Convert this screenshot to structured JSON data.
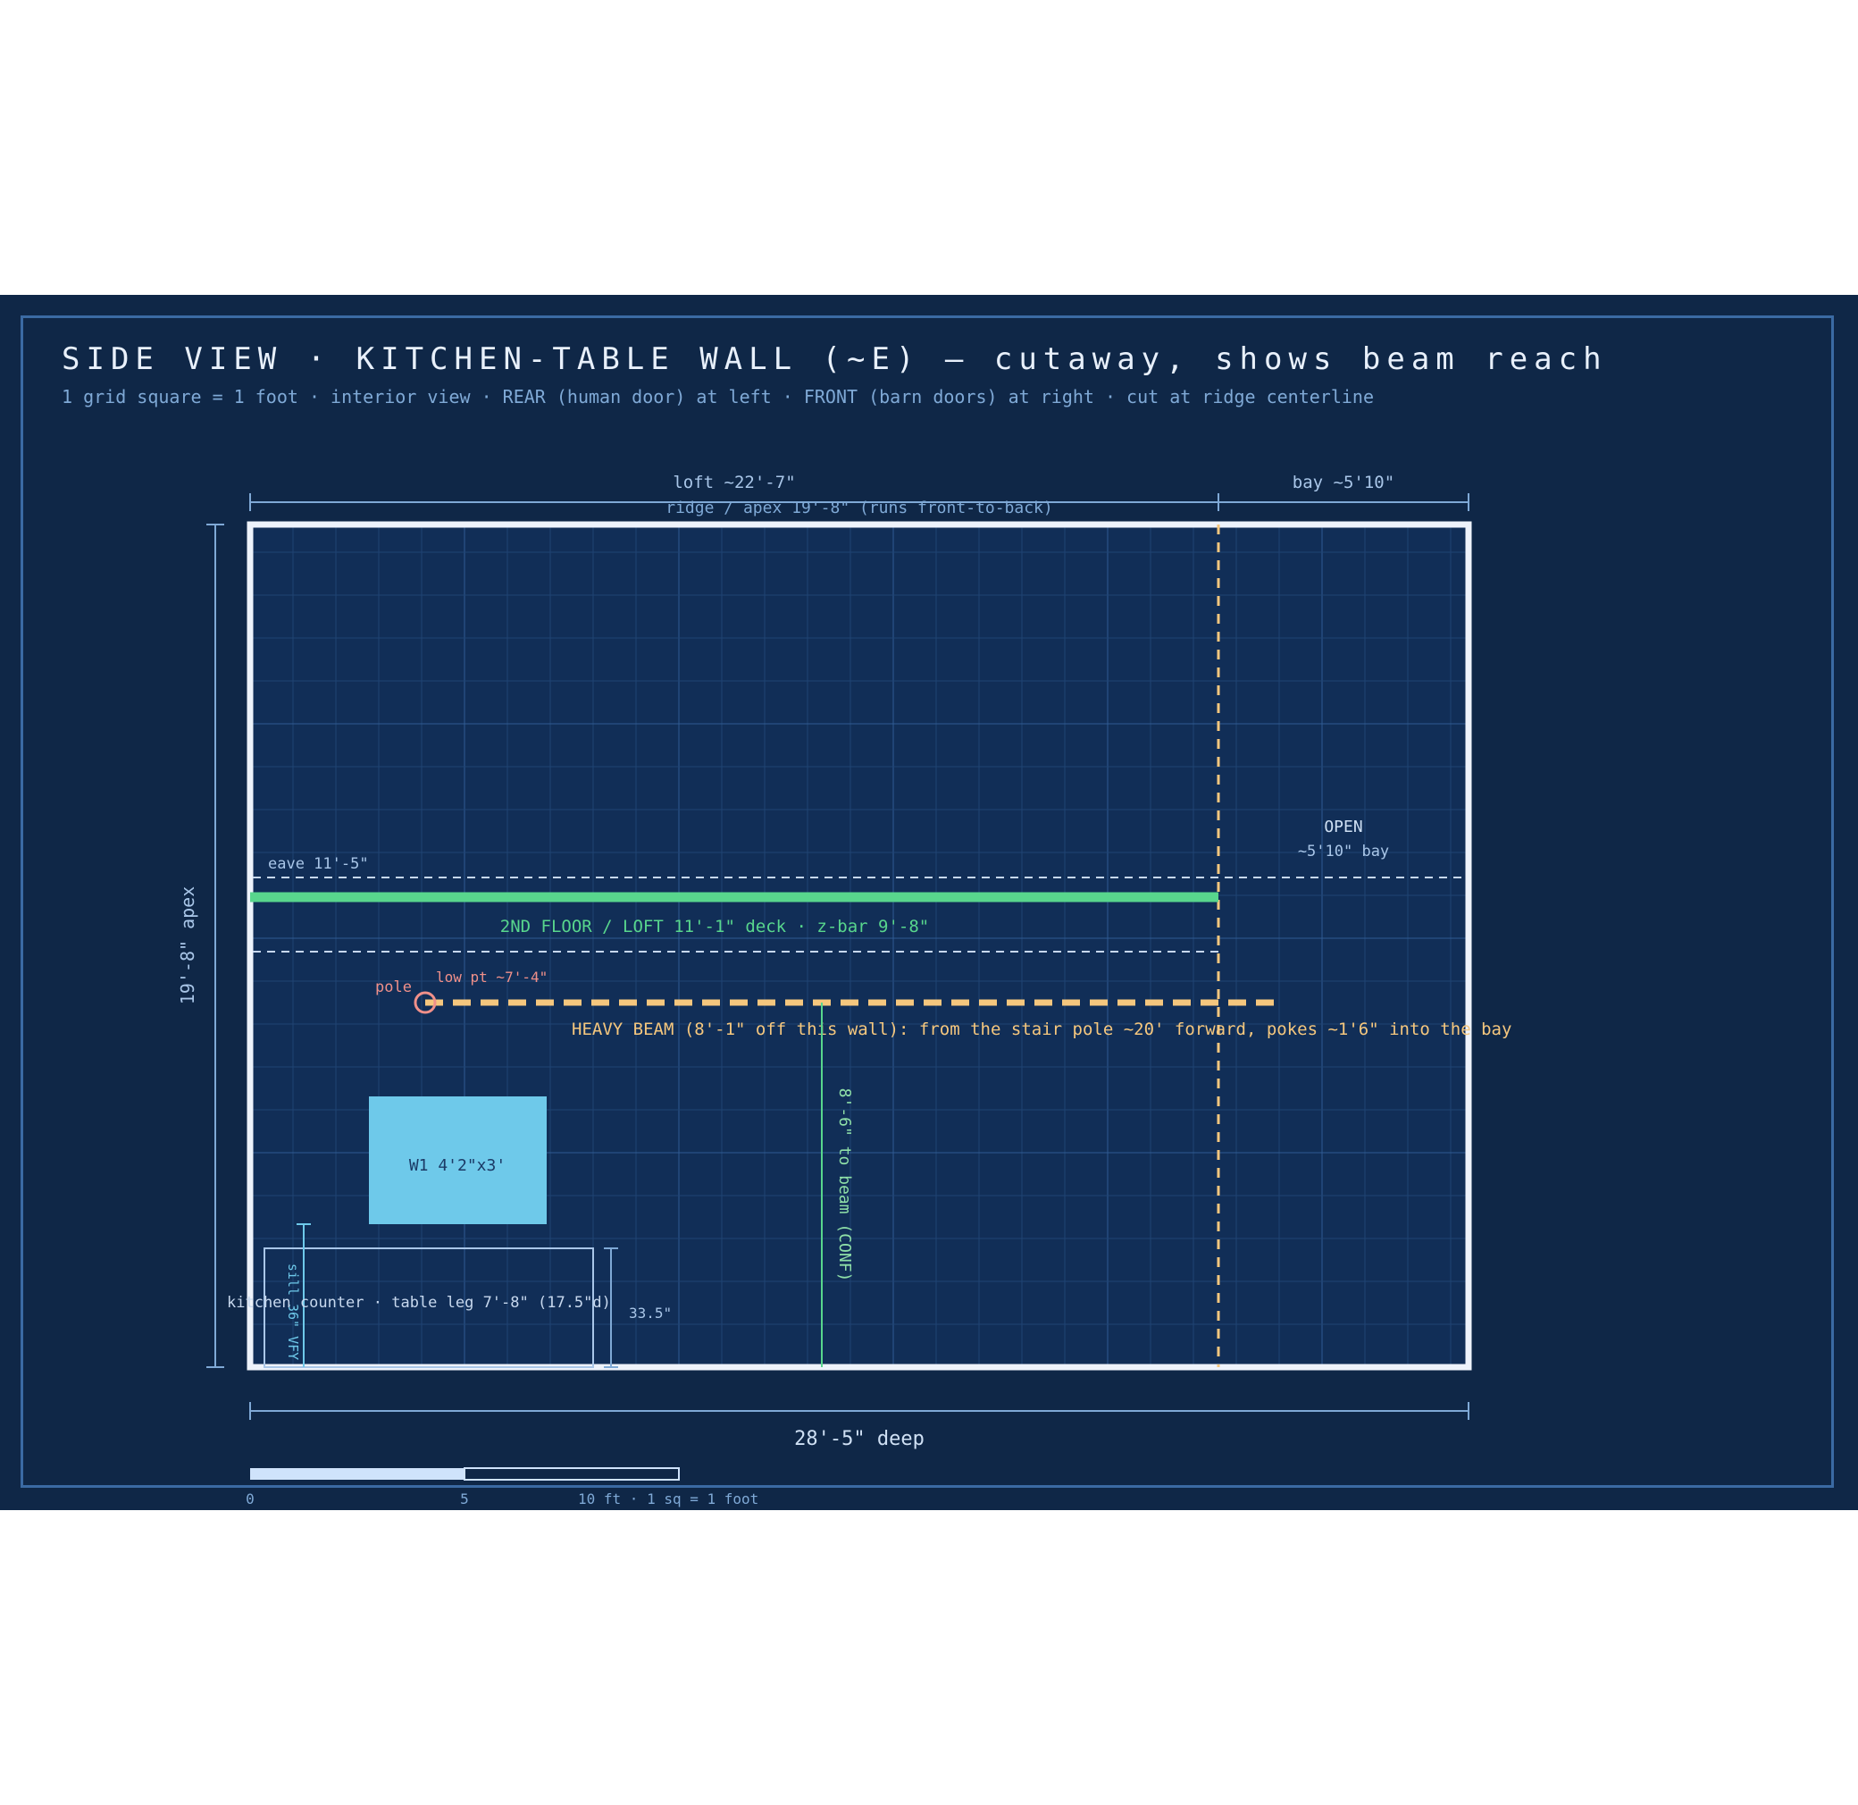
{
  "header": {
    "title": "SIDE VIEW · KITCHEN-TABLE WALL (~E) — cutaway, shows beam reach",
    "subtitle": "1 grid square = 1 foot · interior view · REAR (human door) at left · FRONT (barn doors) at right · cut at ridge centerline"
  },
  "dimensions": {
    "loft_label": "loft ~22'-7\"",
    "bay_label": "bay ~5'10\"",
    "ridge_label": "ridge / apex 19'-8\" (runs front-to-back)",
    "height_label": "19'-8\" apex",
    "depth_label": "28'-5\" deep"
  },
  "annotations": {
    "eave": "eave 11'-5\"",
    "open": "OPEN",
    "open_sub": "~5'10\" bay",
    "loft": "2ND FLOOR / LOFT 11'-1\" deck · z-bar 9'-8\"",
    "pole": "pole",
    "low_pt": "low pt ~7'-4\"",
    "beam": "HEAVY BEAM (8'-1\" off this wall): from the stair pole ~20' forward, pokes ~1'6\" into the bay",
    "window": "W1 4'2\"x3'",
    "counter": "kitchen counter · table leg 7'-8\" (17.5\"d)",
    "counter_height": "33.5\"",
    "sill": "sill 36\" VFY",
    "beam_clearance": "8'-6\" to beam (CONF)"
  },
  "scale_bar": {
    "tick0": "0",
    "tick5": "5",
    "tick10": "10 ft · 1 sq = 1 foot"
  },
  "colors": {
    "background": "#0f2747",
    "panel": "#112e57",
    "wall": "#eef3fb",
    "loft_green": "#58d68d",
    "beam_orange": "#f5c77e",
    "pole_pink": "#f0908a",
    "window_blue": "#6ec9ea",
    "dim_blue": "#7fa9d6"
  }
}
